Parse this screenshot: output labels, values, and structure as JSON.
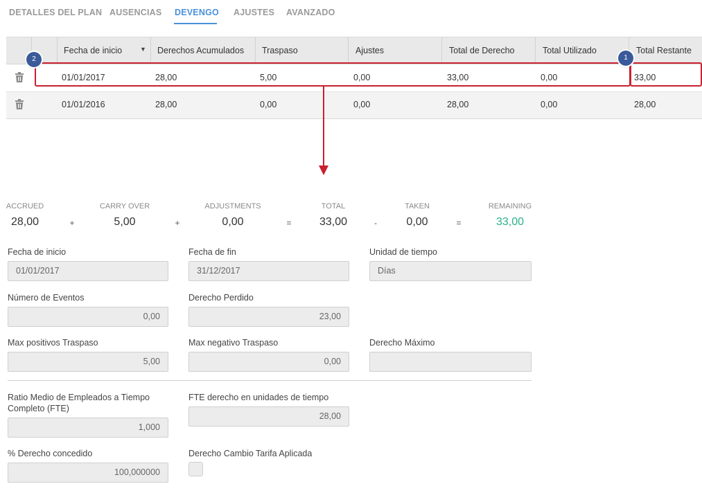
{
  "tabs": [
    {
      "label": "DETALLES DEL PLAN"
    },
    {
      "label": "AUSENCIAS"
    },
    {
      "label": "DEVENGO"
    },
    {
      "label": "AJUSTES"
    },
    {
      "label": "AVANZADO"
    }
  ],
  "active_tab": "DEVENGO",
  "table": {
    "headers": [
      "Fecha de inicio",
      "Derechos Acumulados",
      "Traspaso",
      "Ajustes",
      "Total de Derecho",
      "Total Utilizado",
      "Total Restante"
    ],
    "rows": [
      [
        "01/01/2017",
        "28,00",
        "5,00",
        "0,00",
        "33,00",
        "0,00",
        "33,00"
      ],
      [
        "01/01/2016",
        "28,00",
        "0,00",
        "0,00",
        "28,00",
        "0,00",
        "28,00"
      ]
    ]
  },
  "badges": {
    "one": "1",
    "two": "2"
  },
  "summary": {
    "accrued": {
      "label": "ACCRUED",
      "value": "28,00"
    },
    "carry_over": {
      "label": "CARRY OVER",
      "value": "5,00"
    },
    "adjustments": {
      "label": "ADJUSTMENTS",
      "value": "0,00"
    },
    "total": {
      "label": "TOTAL",
      "value": "33,00"
    },
    "taken": {
      "label": "TAKEN",
      "value": "0,00"
    },
    "remaining": {
      "label": "REMAINING",
      "value": "33,00"
    },
    "ops": [
      "+",
      "+",
      "=",
      "-",
      "="
    ]
  },
  "form": {
    "fecha_inicio": {
      "label": "Fecha de inicio",
      "value": "01/01/2017"
    },
    "fecha_fin": {
      "label": "Fecha de fin",
      "value": "31/12/2017"
    },
    "unidad_tiempo": {
      "label": "Unidad de tiempo",
      "value": "Días"
    },
    "numero_eventos": {
      "label": "Número de Eventos",
      "value": "0,00"
    },
    "derecho_perdido": {
      "label": "Derecho Perdido",
      "value": "23,00"
    },
    "max_positivos": {
      "label": "Max positivos Traspaso",
      "value": "5,00"
    },
    "max_negativo": {
      "label": "Max negativo Traspaso",
      "value": "0,00"
    },
    "derecho_maximo": {
      "label": "Derecho Máximo",
      "value": ""
    },
    "ratio_fte": {
      "label_line1": "Ratio Medio de Empleados a Tiempo",
      "label_line2": "Completo (FTE)",
      "value": "1,000"
    },
    "fte_derecho": {
      "label": "FTE derecho en unidades de tiempo",
      "value": "28,00"
    },
    "pct_derecho": {
      "label": "% Derecho concedido",
      "value": "100,000000"
    },
    "cambio_tarifa": {
      "label": "Derecho Cambio Tarifa Aplicada"
    }
  },
  "colors": {
    "accent": "#4a90d9",
    "highlight": "#c8202e",
    "badge": "#3a5a9a",
    "remaining": "#2ab28a"
  }
}
